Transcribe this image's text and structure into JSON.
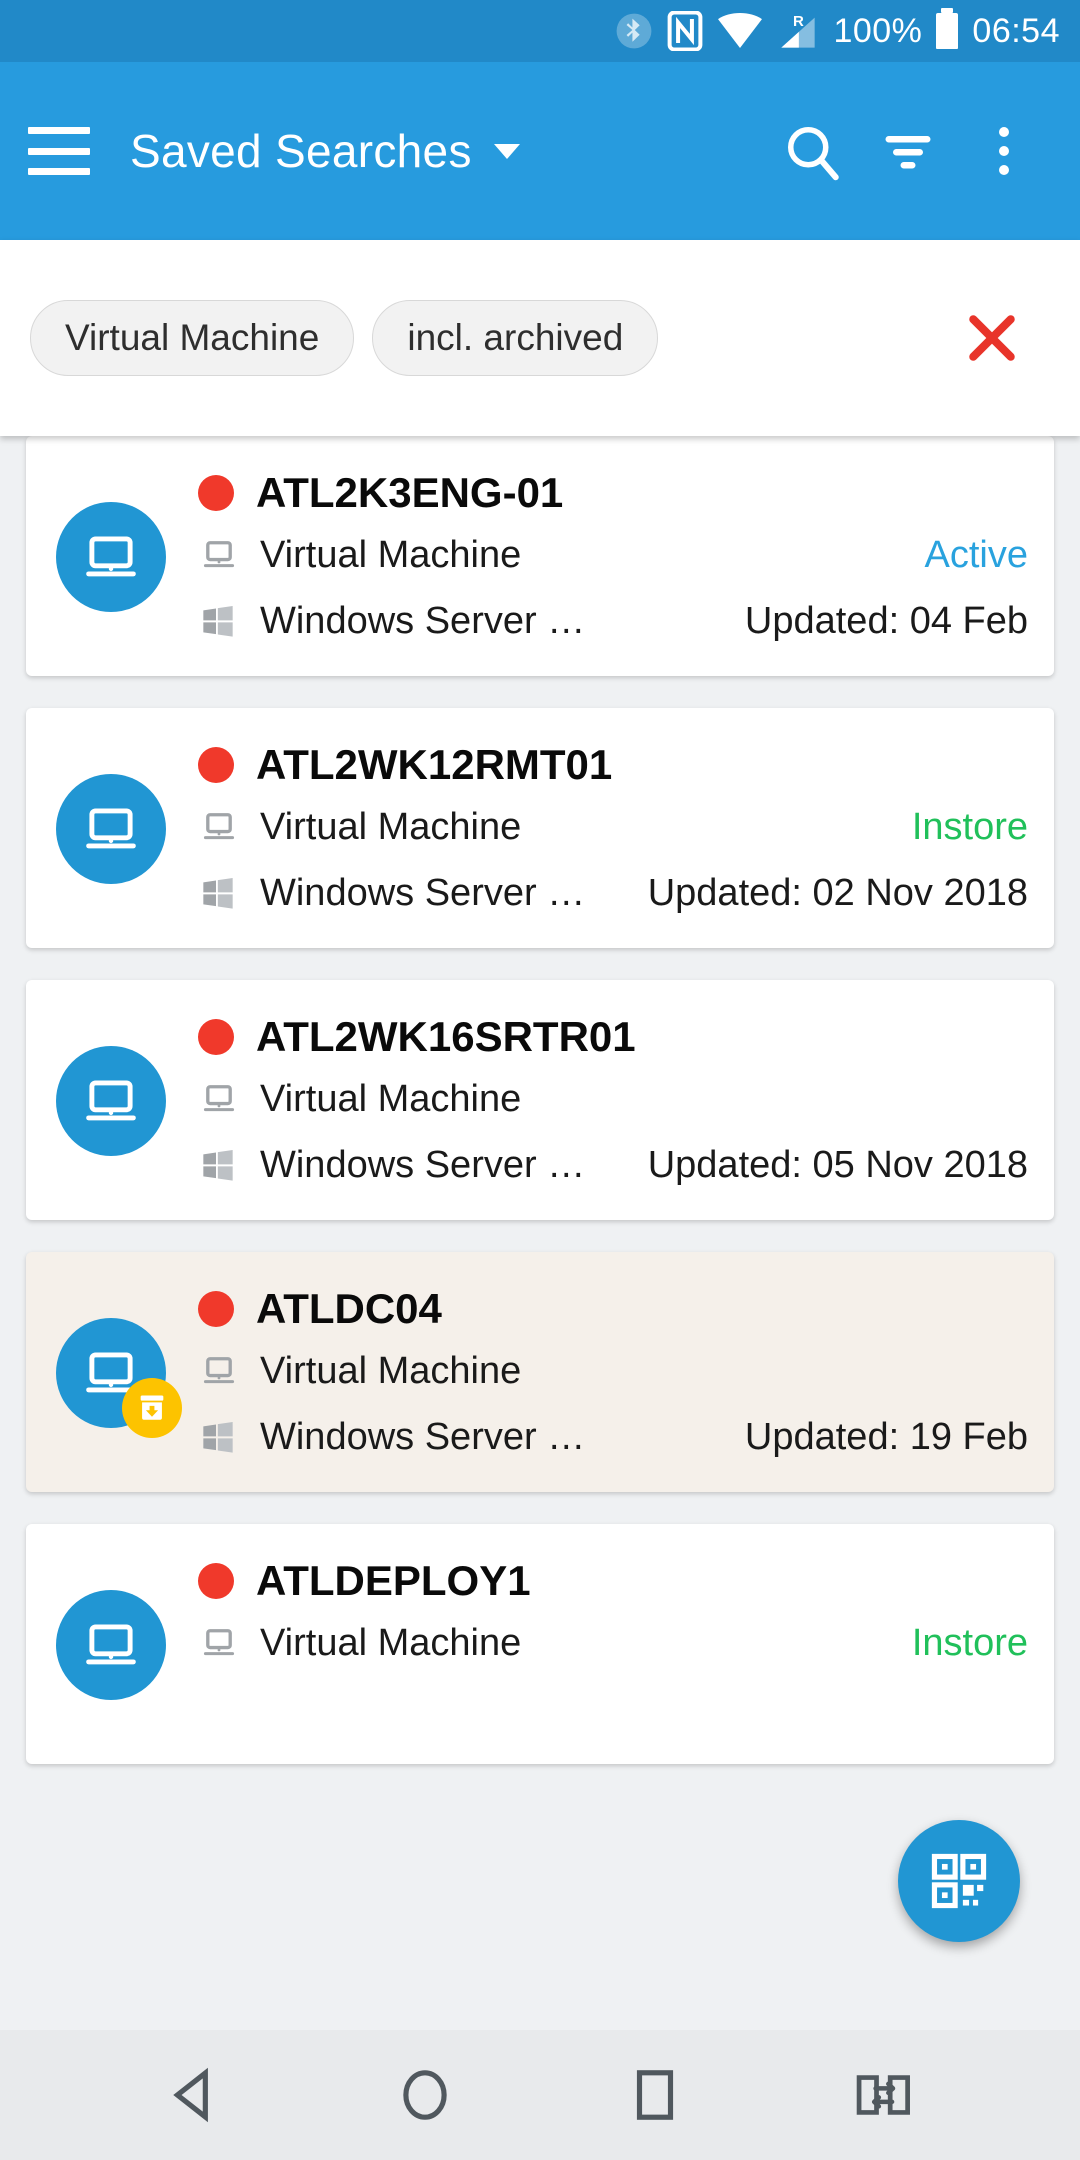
{
  "status_bar": {
    "bluetooth_icon": "bluetooth-icon",
    "nfc_icon": "nfc-icon",
    "wifi_icon": "wifi-icon",
    "signal_icon": "signal-roaming-icon",
    "roaming_label": "R",
    "battery_percent": "100%",
    "battery_icon": "battery-full-icon",
    "time": "06:54"
  },
  "toolbar": {
    "menu_icon": "hamburger-menu-icon",
    "title": "Saved Searches",
    "dropdown_icon": "chevron-down-icon",
    "search_icon": "search-icon",
    "filter_icon": "filter-icon",
    "overflow_icon": "more-vertical-icon"
  },
  "filter_bar": {
    "chips": [
      {
        "label": "Virtual Machine"
      },
      {
        "label": "incl. archived"
      }
    ],
    "clear_icon": "close-x-icon",
    "clear_color": "#E8342A"
  },
  "colors": {
    "status_bar": "#2189C8",
    "toolbar": "#279BDE",
    "accent": "#2196D3",
    "page_bg": "#EFF1F3",
    "card_bg": "#FFFFFF",
    "archived_card_bg": "#F5F0EA",
    "status_dot": "#F0392B",
    "active_text": "#29A2DE",
    "instore_text": "#20C05A",
    "badge": "#FDC300",
    "nav_bar": "#E8EAEC"
  },
  "list": {
    "items": [
      {
        "hostname": "ATL2K3ENG-01",
        "status_dot": "red",
        "device_icon": "laptop-icon",
        "device_type": "Virtual Machine",
        "os_icon": "windows-icon",
        "os": "Windows Server …",
        "status": "Active",
        "status_kind": "active",
        "updated": "Updated: 04 Feb",
        "archived": false,
        "avatar_icon": "laptop-avatar-icon"
      },
      {
        "hostname": "ATL2WK12RMT01",
        "status_dot": "red",
        "device_icon": "laptop-icon",
        "device_type": "Virtual Machine",
        "os_icon": "windows-icon",
        "os": "Windows Server …",
        "status": "Instore",
        "status_kind": "instore",
        "updated": "Updated: 02 Nov 2018",
        "archived": false,
        "avatar_icon": "laptop-avatar-icon"
      },
      {
        "hostname": "ATL2WK16SRTR01",
        "status_dot": "red",
        "device_icon": "laptop-icon",
        "device_type": "Virtual Machine",
        "os_icon": "windows-icon",
        "os": "Windows Server …",
        "status": "",
        "status_kind": "none",
        "updated": "Updated: 05 Nov 2018",
        "archived": false,
        "avatar_icon": "laptop-avatar-icon"
      },
      {
        "hostname": "ATLDC04",
        "status_dot": "red",
        "device_icon": "laptop-icon",
        "device_type": "Virtual Machine",
        "os_icon": "windows-icon",
        "os": "Windows Server …",
        "status": "",
        "status_kind": "none",
        "updated": "Updated: 19 Feb",
        "archived": true,
        "archive_badge_icon": "archive-box-icon",
        "avatar_icon": "laptop-avatar-icon"
      },
      {
        "hostname": "ATLDEPLOY1",
        "status_dot": "red",
        "device_icon": "laptop-icon",
        "device_type": "Virtual Machine",
        "os_icon": "windows-icon",
        "os": "",
        "status": "Instore",
        "status_kind": "instore",
        "updated": "",
        "archived": false,
        "avatar_icon": "laptop-avatar-icon"
      }
    ]
  },
  "fab": {
    "icon": "qr-code-scan-icon"
  },
  "nav_bar": {
    "back_icon": "back-triangle-icon",
    "home_icon": "home-circle-icon",
    "recents_icon": "recents-square-icon",
    "switch_icon": "screen-switch-icon"
  }
}
